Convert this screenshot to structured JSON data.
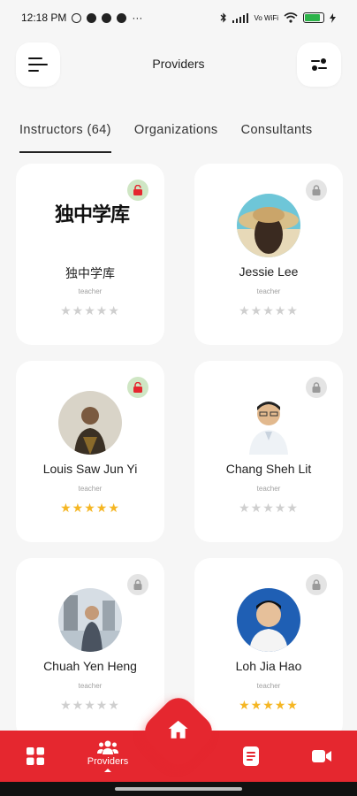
{
  "status_bar": {
    "time": "12:18 PM",
    "icons": [
      "alarm-icon",
      "notification-icon",
      "notification-icon",
      "check-icon"
    ],
    "more": "···",
    "network": "Vo WiFi",
    "battery_level": 0.85
  },
  "header": {
    "title": "Providers",
    "menu_icon": "menu-icon",
    "filter_icon": "filter-icon"
  },
  "tabs": [
    {
      "label": "Instructors (64)",
      "active": true
    },
    {
      "label": "Organizations",
      "active": false
    },
    {
      "label": "Consultants",
      "active": false
    }
  ],
  "providers": [
    {
      "name": "独中学库",
      "role": "teacher",
      "rating": 0,
      "lock": "unlocked-green",
      "logo_text": "独中学库"
    },
    {
      "name": "Jessie Lee",
      "role": "teacher",
      "rating": 0,
      "lock": "locked-grey"
    },
    {
      "name": "Louis Saw Jun Yi",
      "role": "teacher",
      "rating": 5,
      "lock": "unlocked-green"
    },
    {
      "name": "Chang Sheh Lit",
      "role": "teacher",
      "rating": 0,
      "lock": "locked-grey"
    },
    {
      "name": "Chuah Yen Heng",
      "role": "teacher",
      "rating": 0,
      "lock": "locked-grey"
    },
    {
      "name": "Loh Jia Hao",
      "role": "teacher",
      "rating": 5,
      "lock": "locked-grey"
    }
  ],
  "bottom_nav": {
    "items": [
      {
        "icon": "grid-icon",
        "label": ""
      },
      {
        "icon": "people-icon",
        "label": "Providers"
      },
      {
        "icon": "home-icon",
        "label": ""
      },
      {
        "icon": "document-icon",
        "label": ""
      },
      {
        "icon": "video-icon",
        "label": ""
      }
    ],
    "accent": "#e5272f"
  },
  "colors": {
    "accent": "#e5272f",
    "star_on": "#f5b623",
    "star_off": "#cfcfcf",
    "lock_green": "#cfe6c4",
    "lock_grey": "#e4e4e4"
  }
}
